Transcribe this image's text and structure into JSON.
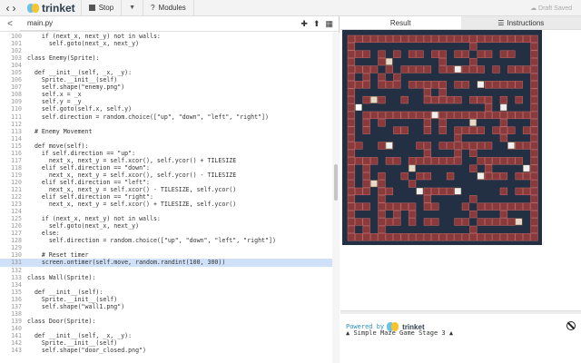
{
  "toolbar": {
    "brand": "trinket",
    "stop_label": "Stop",
    "modules_label": "Modules",
    "draft_status": "Draft Saved"
  },
  "editor": {
    "filename": "main.py",
    "lines": [
      {
        "n": "100",
        "t": "    if (next_x, next_y) not in walls:"
      },
      {
        "n": "101",
        "t": "      self.goto(next_x, next_y)"
      },
      {
        "n": "102",
        "t": ""
      },
      {
        "n": "103",
        "t": "class Enemy(Sprite):"
      },
      {
        "n": "104",
        "t": ""
      },
      {
        "n": "105",
        "t": "  def __init__(self, _x, _y):"
      },
      {
        "n": "106",
        "t": "    Sprite.__init__(self)"
      },
      {
        "n": "107",
        "t": "    self.shape(\"enemy.png\")"
      },
      {
        "n": "108",
        "t": "    self.x = _x"
      },
      {
        "n": "109",
        "t": "    self.y = _y"
      },
      {
        "n": "110",
        "t": "    self.goto(self.x, self.y)"
      },
      {
        "n": "111",
        "t": "    self.direction = random.choice([\"up\", \"down\", \"left\", \"right\"])"
      },
      {
        "n": "112",
        "t": ""
      },
      {
        "n": "113",
        "t": "  # Enemy Movement"
      },
      {
        "n": "114",
        "t": ""
      },
      {
        "n": "115",
        "t": "  def move(self):"
      },
      {
        "n": "116",
        "t": "    if self.direction == \"up\":"
      },
      {
        "n": "117",
        "t": "      next_x, next_y = self.xcor(), self.ycor() + TILESIZE"
      },
      {
        "n": "118",
        "t": "    elif self.direction == \"down\":"
      },
      {
        "n": "119",
        "t": "      next_x, next_y = self.xcor(), self.ycor() - TILESIZE"
      },
      {
        "n": "120",
        "t": "    elif self.direction == \"left\":"
      },
      {
        "n": "121",
        "t": "      next_x, next_y = self.xcor() - TILESIZE, self.ycor()"
      },
      {
        "n": "122",
        "t": "    elif self.direction == \"right\":"
      },
      {
        "n": "123",
        "t": "      next_x, next_y = self.xcor() + TILESIZE, self.ycor()"
      },
      {
        "n": "124",
        "t": ""
      },
      {
        "n": "125",
        "t": "    if (next_x, next_y) not in walls:"
      },
      {
        "n": "126",
        "t": "      self.goto(next_x, next_y)"
      },
      {
        "n": "127",
        "t": "    else:"
      },
      {
        "n": "128",
        "t": "      self.direction = random.choice([\"up\", \"down\", \"left\", \"right\"])"
      },
      {
        "n": "129",
        "t": ""
      },
      {
        "n": "130",
        "t": "    # Reset timer"
      },
      {
        "n": "131",
        "t": "    screen.ontimer(self.move, random.randint(100, 300))"
      },
      {
        "n": "132",
        "t": ""
      },
      {
        "n": "133",
        "t": "class Wall(Sprite):"
      },
      {
        "n": "134",
        "t": ""
      },
      {
        "n": "135",
        "t": "  def __init__(self):"
      },
      {
        "n": "136",
        "t": "    Sprite.__init__(self)"
      },
      {
        "n": "137",
        "t": "    self.shape(\"wall1.png\")"
      },
      {
        "n": "138",
        "t": ""
      },
      {
        "n": "139",
        "t": "class Door(Sprite):"
      },
      {
        "n": "140",
        "t": ""
      },
      {
        "n": "141",
        "t": "  def __init__(self, _x, _y):"
      },
      {
        "n": "142",
        "t": "    Sprite.__init__(self)"
      },
      {
        "n": "143",
        "t": "    self.shape(\"door_closed.png\")"
      }
    ],
    "highlighted_line": "131"
  },
  "result_panel": {
    "tab_result": "Result",
    "tab_instructions": "Instructions",
    "powered_by": "Powered by",
    "powered_brand": "trinket",
    "console_title": "Simple Maze Game Stage 3"
  },
  "colors": {
    "maze_bg": "#233043",
    "wall": "#8a3a3a",
    "wall_border": "#c46a6a",
    "highlight": "#cfe0f9",
    "brand_blue": "#6cc2e6",
    "brand_yellow": "#f7c52a"
  },
  "icons": [
    "chevron-left-icon",
    "chevron-right-icon",
    "stop-square-icon",
    "question-icon",
    "plus-icon",
    "upload-icon",
    "image-icon",
    "list-icon",
    "stop-circle-icon"
  ]
}
